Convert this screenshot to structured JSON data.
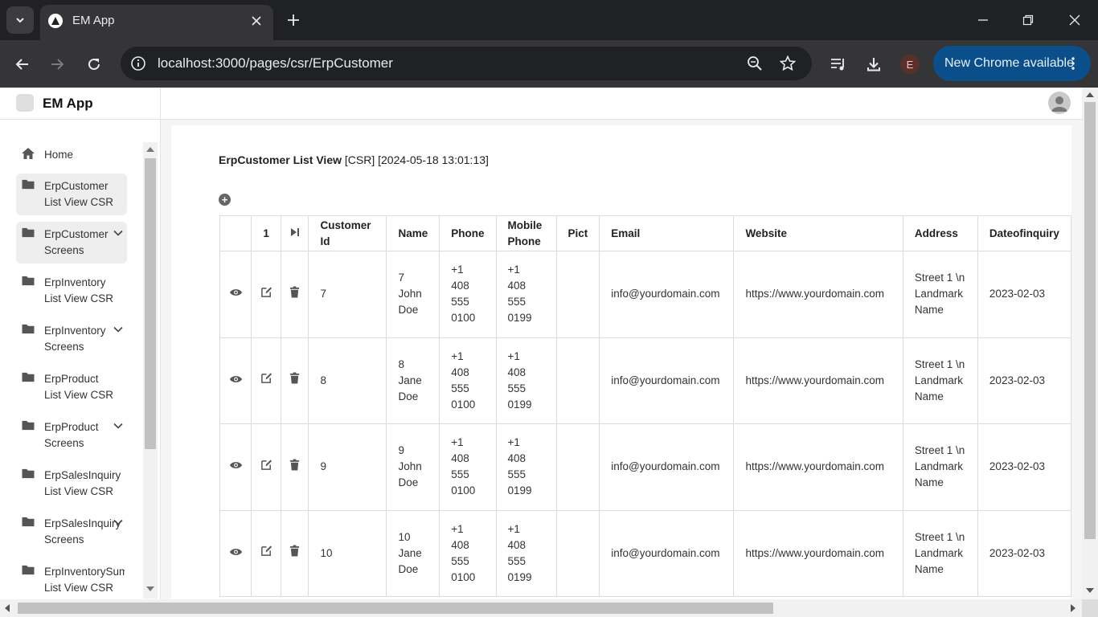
{
  "browser": {
    "tab_title": "EM App",
    "url": "localhost:3000/pages/csr/ErpCustomer",
    "profile_initial": "E",
    "update_label": "New Chrome available"
  },
  "app": {
    "name": "EM App"
  },
  "sidebar": {
    "items": [
      {
        "line1": "Home",
        "line2": "",
        "icon": "home-icon",
        "expandable": false,
        "active": false
      },
      {
        "line1": "ErpCustomer",
        "line2": "List View CSR",
        "icon": "folder-icon",
        "expandable": false,
        "active": true
      },
      {
        "line1": "ErpCustomer",
        "line2": "Screens",
        "icon": "folder-icon",
        "expandable": true,
        "active": true
      },
      {
        "line1": "ErpInventory",
        "line2": "List View CSR",
        "icon": "folder-icon",
        "expandable": false,
        "active": false
      },
      {
        "line1": "ErpInventory",
        "line2": "Screens",
        "icon": "folder-icon",
        "expandable": true,
        "active": false
      },
      {
        "line1": "ErpProduct",
        "line2": "List View CSR",
        "icon": "folder-icon",
        "expandable": false,
        "active": false
      },
      {
        "line1": "ErpProduct",
        "line2": "Screens",
        "icon": "folder-icon",
        "expandable": true,
        "active": false
      },
      {
        "line1": "ErpSalesInquiry",
        "line2": "List View CSR",
        "icon": "folder-icon",
        "expandable": false,
        "active": false
      },
      {
        "line1": "ErpSalesInquiry",
        "line2": "Screens",
        "icon": "folder-icon",
        "expandable": true,
        "active": false
      },
      {
        "line1": "ErpInventorySumVw",
        "line2": "List View CSR",
        "icon": "folder-icon",
        "expandable": false,
        "active": false
      }
    ]
  },
  "page": {
    "heading_bold": "ErpCustomer List View",
    "heading_rest": " [CSR] [2024-05-18 13:01:13]",
    "add_symbol": "+"
  },
  "table": {
    "page_number": "1",
    "columns": [
      "Customer Id",
      "Name",
      "Phone",
      "Mobile Phone",
      "Pict",
      "Email",
      "Website",
      "Address",
      "Dateofinquiry"
    ],
    "rows": [
      {
        "customer_id": "7",
        "name": "7 John Doe",
        "phone": "+1 408 555 0100",
        "mobile": "+1 408 555 0199",
        "pict": "",
        "email": "info@yourdomain.com",
        "website": "https://www.yourdomain.com",
        "address": "Street 1 \\n Landmark Name",
        "date": "2023-02-03"
      },
      {
        "customer_id": "8",
        "name": "8 Jane Doe",
        "phone": "+1 408 555 0100",
        "mobile": "+1 408 555 0199",
        "pict": "",
        "email": "info@yourdomain.com",
        "website": "https://www.yourdomain.com",
        "address": "Street 1 \\n Landmark Name",
        "date": "2023-02-03"
      },
      {
        "customer_id": "9",
        "name": "9 John Doe",
        "phone": "+1 408 555 0100",
        "mobile": "+1 408 555 0199",
        "pict": "",
        "email": "info@yourdomain.com",
        "website": "https://www.yourdomain.com",
        "address": "Street 1 \\n Landmark Name",
        "date": "2023-02-03"
      },
      {
        "customer_id": "10",
        "name": "10 Jane Doe",
        "phone": "+1 408 555 0100",
        "mobile": "+1 408 555 0199",
        "pict": "",
        "email": "info@yourdomain.com",
        "website": "https://www.yourdomain.com",
        "address": "Street 1 \\n Landmark Name",
        "date": "2023-02-03"
      }
    ]
  },
  "colors": {
    "chrome_dark": "#202124",
    "chrome_toolbar": "#353538",
    "update_blue": "#0b4f8a",
    "sidebar_active": "#eeeeee",
    "icon_gray": "#555555"
  }
}
